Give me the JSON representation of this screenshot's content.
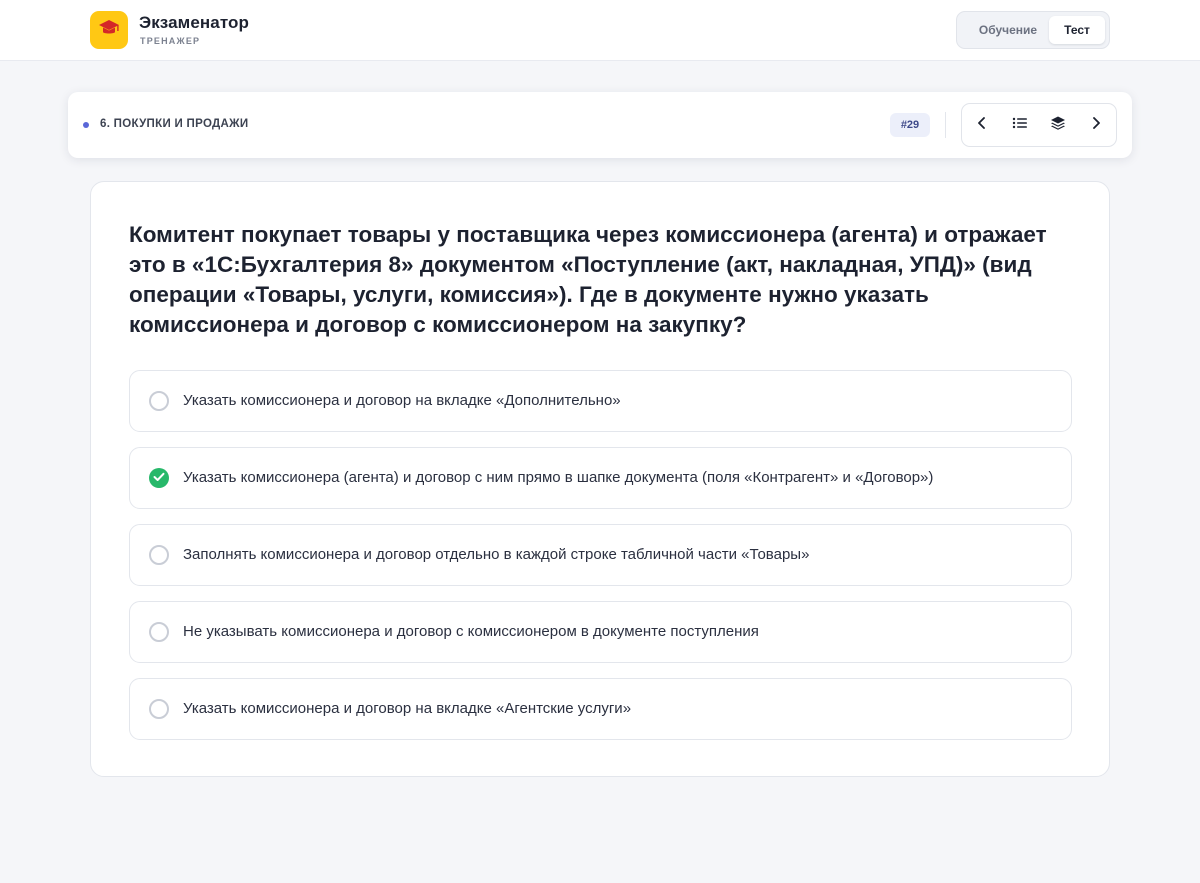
{
  "header": {
    "app_title": "Экзаменатор",
    "app_subtitle": "ТРЕНАЖЕР",
    "modes": {
      "learn_label": "Обучение",
      "test_label": "Тест",
      "active": "Тест"
    }
  },
  "topic": {
    "category": "6. ПОКУПКИ И ПРОДАЖИ",
    "question_number": "#29",
    "nav_icons": [
      "chevron-left-icon",
      "list-icon",
      "layers-icon",
      "chevron-right-icon"
    ]
  },
  "question": {
    "text": "Комитент покупает товары у поставщика через комиссионера (агента) и отражает это в «1С:Бухгалтерия 8» документом «Поступление (акт, накладная, УПД)» (вид операции «Товары, услуги, комиссия»). Где в документе нужно указать комиссионера и договор с комиссионером на закупку?",
    "options": [
      {
        "text": "Указать комиссионера и договор на вкладке «Дополнительно»"
      },
      {
        "text": "Указать комиссионера (агента) и договор с ним прямо в шапке документа (поля «Контрагент» и «Договор»)"
      },
      {
        "text": "Заполнять комиссионера и договор отдельно в каждой строке табличной части «Товары»"
      },
      {
        "text": "Не указывать комиссионера и договор с комиссионером в документе поступления"
      },
      {
        "text": "Указать комиссионера и договор на вкладке «Агентские услуги»"
      }
    ],
    "selected_option": 1
  },
  "colors": {
    "accent_yellow": "#ffc814",
    "success_green": "#27b86a",
    "badge_bg": "#eceffa",
    "category_dot": "#5a67d8"
  }
}
